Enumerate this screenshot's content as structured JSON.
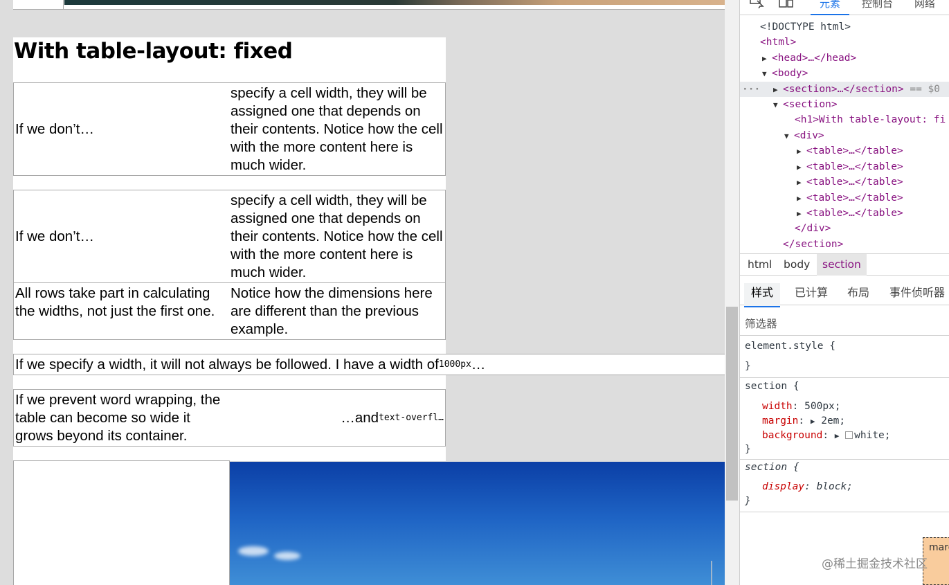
{
  "page": {
    "heading": "With table-layout: fixed",
    "tables": [
      {
        "c1": "If we don’t…",
        "c2": "specify a cell width, they will be assigned one that depends on their contents. Notice how the cell with the more content here is much wider."
      },
      {
        "c1": "If we don’t…",
        "c2": "specify a cell width, they will be assigned one that depends on their contents. Notice how the cell with the more content here is much wider."
      },
      {
        "c1": "All rows take part in calculating the widths, not just the first one.",
        "c2": "Notice how the dimensions here are different than the previous example."
      },
      {
        "wide_text": "If we specify a width, it will not always be followed. I have a width of ",
        "wide_code": "1000px",
        "wide_tail": "…"
      },
      {
        "c1": "If we prevent word wrapping, the table can become so wide it grows beyond its container.",
        "c2_text": "…and ",
        "c2_code": "text-overfl…"
      }
    ]
  },
  "devtools": {
    "tabs": [
      "元素",
      "控制台",
      "网络"
    ],
    "dom": {
      "doctype": "<!DOCTYPE html>",
      "html": "<html>",
      "head": "<head>…</head>",
      "body": "<body>",
      "section_collapsed": "<section>…</section>",
      "selected_suffix": "== $0",
      "section_open": "<section>",
      "h1": "<h1>With table-layout: fi",
      "div": "<div>",
      "table": "<table>…</table>",
      "div_close": "</div>",
      "section_close": "</section>",
      "ellipsis": "···"
    },
    "breadcrumbs": [
      "html",
      "body",
      "section"
    ],
    "subtabs": [
      "样式",
      "已计算",
      "布局",
      "事件侦听器"
    ],
    "filter_placeholder": "筛选器",
    "rules": {
      "element_style": "element.style {",
      "close": "}",
      "section_selector": "section {",
      "width_prop": "width",
      "width_val": "500px;",
      "margin_prop": "margin",
      "margin_val": "2em;",
      "bg_prop": "background",
      "bg_val": "white;",
      "ua_selector": "section {",
      "display_prop": "display",
      "display_val": "block;"
    },
    "boxmodel_label": "marg"
  },
  "watermark": "@稀土掘金技术社区"
}
